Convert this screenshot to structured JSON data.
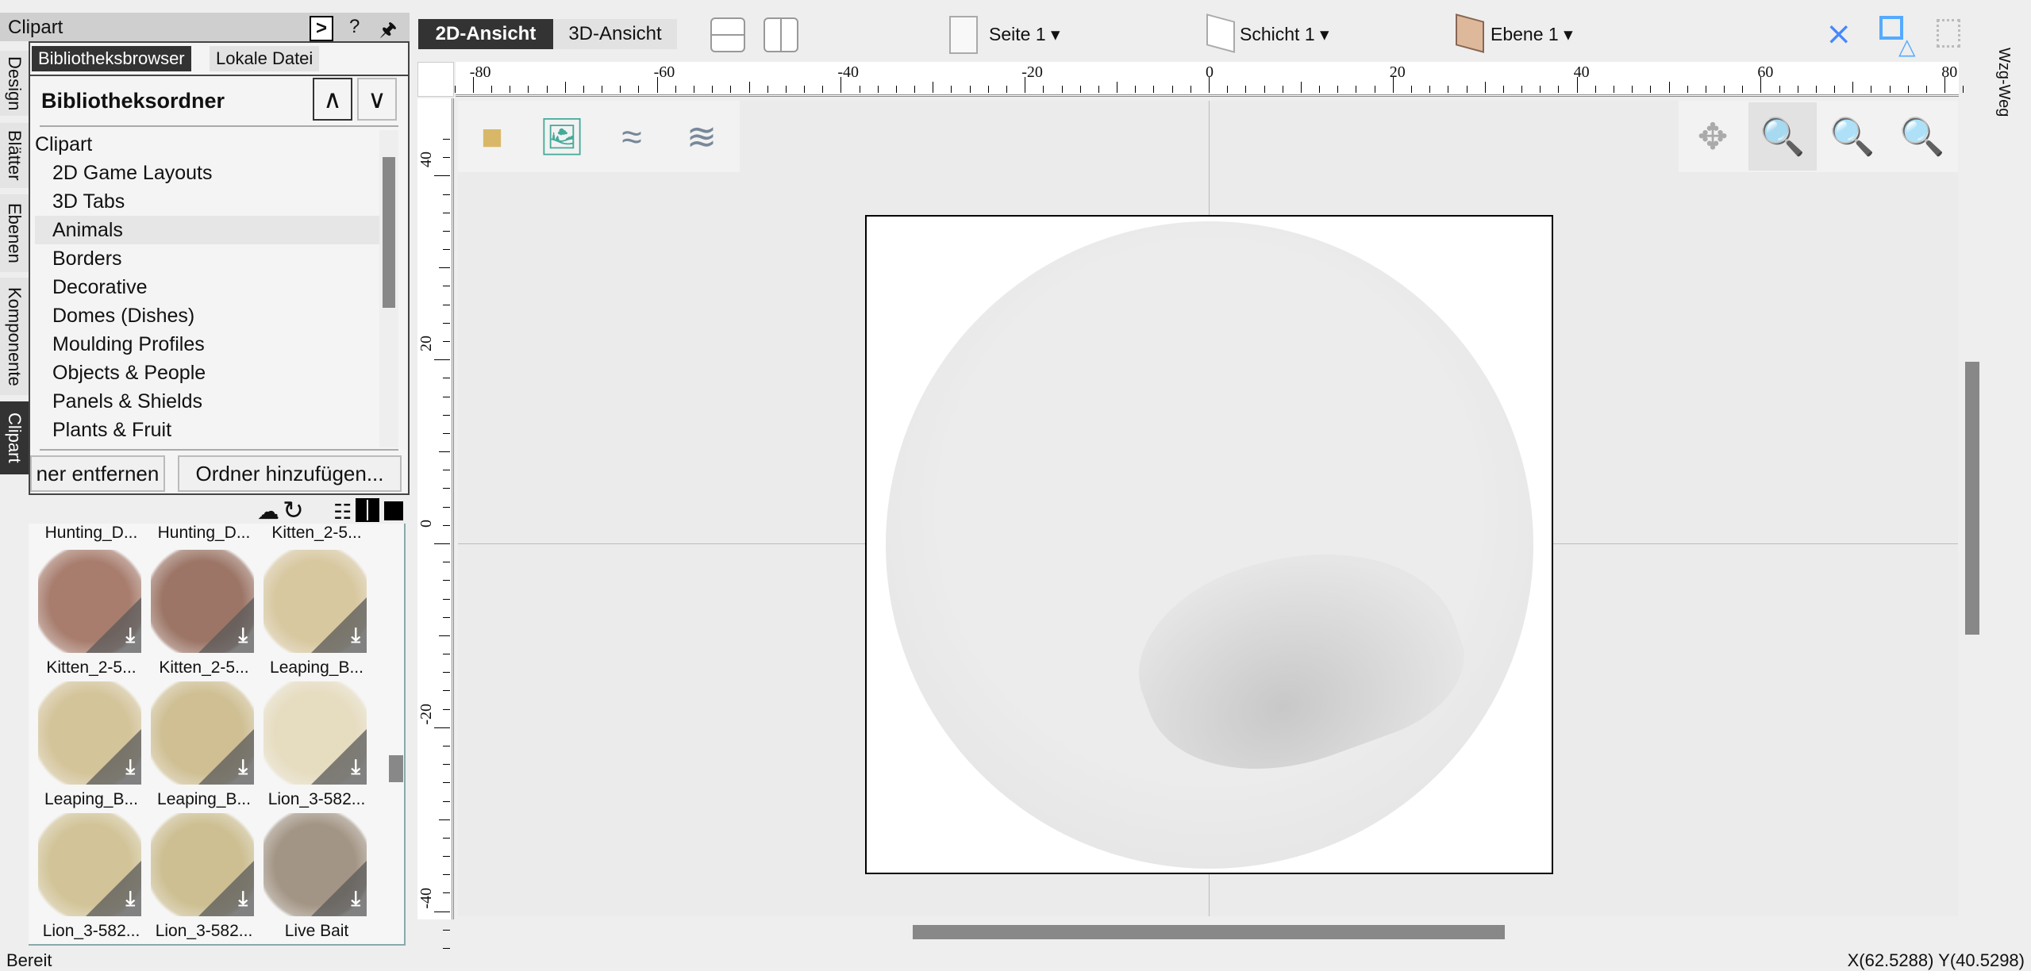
{
  "panel": {
    "title": "Clipart",
    "tabs": [
      "Bibliotheksbrowser",
      "Lokale Datei"
    ],
    "section_title": "Bibliotheksordner",
    "folders": [
      "Clipart",
      "2D Game Layouts",
      "3D Tabs",
      "Animals",
      "Borders",
      "Decorative",
      "Domes (Dishes)",
      "Moulding Profiles",
      "Objects & People",
      "Panels & Shields",
      "Plants & Fruit"
    ],
    "selected_folder": "Animals",
    "remove_button": "ner entfernen",
    "add_button": "Ordner hinzufügen..."
  },
  "side_tabs": [
    "Design",
    "Blätter",
    "Ebenen",
    "Komponente",
    "Clipart"
  ],
  "right_tab": "Wzg-Weg",
  "grid": {
    "top_labels": [
      "Hunting_D...",
      "Hunting_D...",
      "Kitten_2-5..."
    ],
    "items": [
      {
        "label": "Kitten_2-5...",
        "color": "#a87d6e"
      },
      {
        "label": "Kitten_2-5...",
        "color": "#9c7566"
      },
      {
        "label": "Leaping_B...",
        "color": "#d8c8a0"
      },
      {
        "label": "Leaping_B...",
        "color": "#d4c49a"
      },
      {
        "label": "Leaping_B...",
        "color": "#cfbf93"
      },
      {
        "label": "Lion_3-582...",
        "color": "#e6dcc0"
      },
      {
        "label": "Lion_3-582...",
        "color": "#d2c498"
      },
      {
        "label": "Lion_3-582...",
        "color": "#cdbf92"
      },
      {
        "label": "Live Bait",
        "color": "#a39585"
      }
    ]
  },
  "view_tabs": {
    "active": "2D-Ansicht",
    "other": "3D-Ansicht"
  },
  "toolbar": {
    "page": "Seite 1",
    "sheet": "Schicht 1",
    "level": "Ebene 1"
  },
  "ruler": {
    "labels": [
      "-80",
      "-60",
      "-40",
      "-20",
      "0",
      "20",
      "40",
      "60",
      "80"
    ],
    "vlabels": [
      "40",
      "20",
      "0",
      "-20",
      "-40"
    ]
  },
  "status": {
    "left": "Bereit",
    "coords": "X(62.5288) Y(40.5298)"
  }
}
